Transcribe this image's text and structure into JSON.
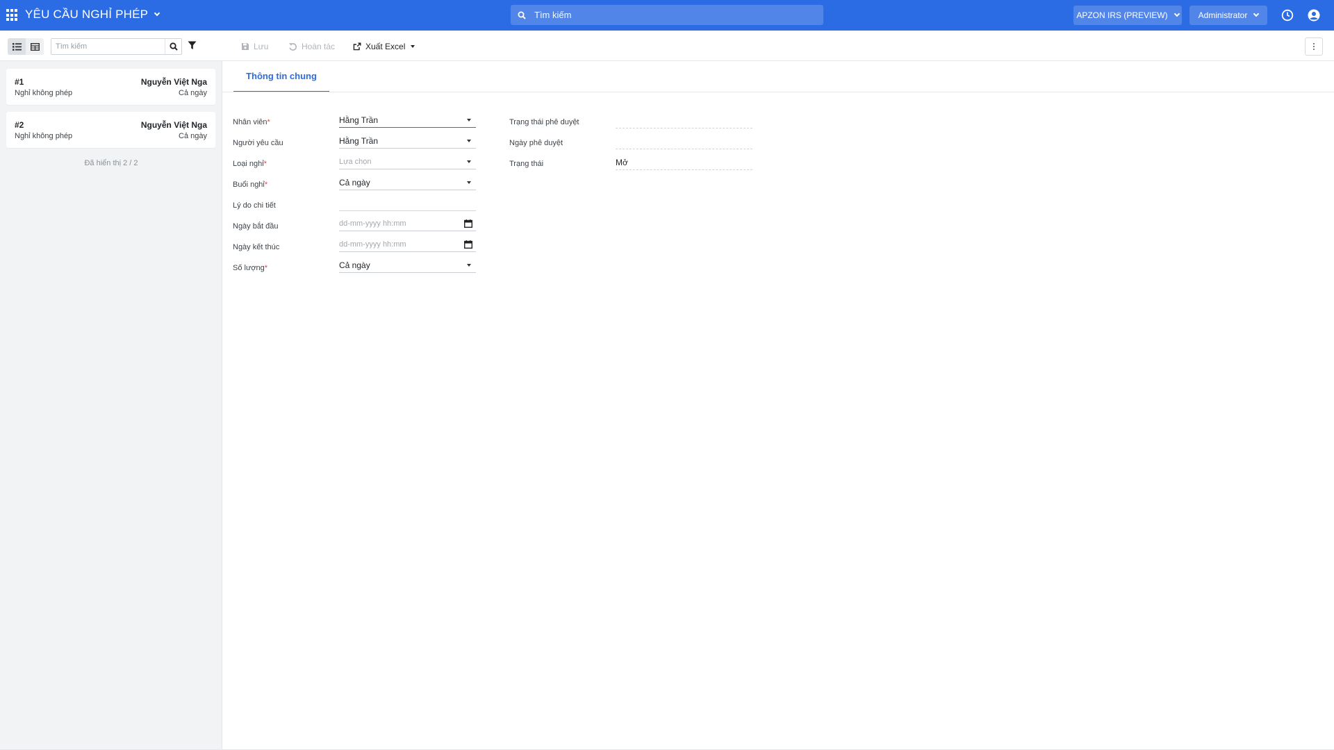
{
  "navbar": {
    "app_title": "YÊU CẦU NGHỈ PHÉP",
    "search_placeholder": "Tìm kiếm",
    "company": "APZON IRS (PREVIEW)",
    "user": "Administrator",
    "color": "#2b6be3"
  },
  "controlbar": {
    "search_placeholder": "Tìm kiếm",
    "save_label": "Lưu",
    "undo_label": "Hoàn tác",
    "export_label": "Xuất Excel"
  },
  "records": [
    {
      "num": "#1",
      "name": "Nguyễn Việt Nga",
      "type": "Nghỉ không phép",
      "session": "Cả ngày"
    },
    {
      "num": "#2",
      "name": "Nguyễn Việt Nga",
      "type": "Nghỉ không phép",
      "session": "Cả ngày"
    }
  ],
  "shown_count": "Đã hiển thị 2 / 2",
  "form": {
    "tab_general": "Thông tin chung",
    "required_mark": "*",
    "labels": {
      "employee": "Nhân viên",
      "requester": "Người yêu cầu",
      "leave_type": "Loại nghỉ",
      "session": "Buổi nghỉ",
      "reason": "Lý do chi tiết",
      "start_date": "Ngày bắt đầu",
      "end_date": "Ngày kết thúc",
      "quantity": "Số lượng",
      "approval_status": "Trạng thái phê duyệt",
      "approval_date": "Ngày phê duyệt",
      "status": "Trạng thái"
    },
    "values": {
      "employee": "Hằng Trần",
      "requester": "Hằng Trần",
      "leave_type_placeholder": "Lựa chọn",
      "session": "Cả ngày",
      "reason": "",
      "start_date_placeholder": "dd-mm-yyyy hh:mm",
      "end_date_placeholder": "dd-mm-yyyy hh:mm",
      "quantity": "Cả ngày",
      "approval_status": "",
      "approval_date": "",
      "status": "Mở"
    }
  }
}
